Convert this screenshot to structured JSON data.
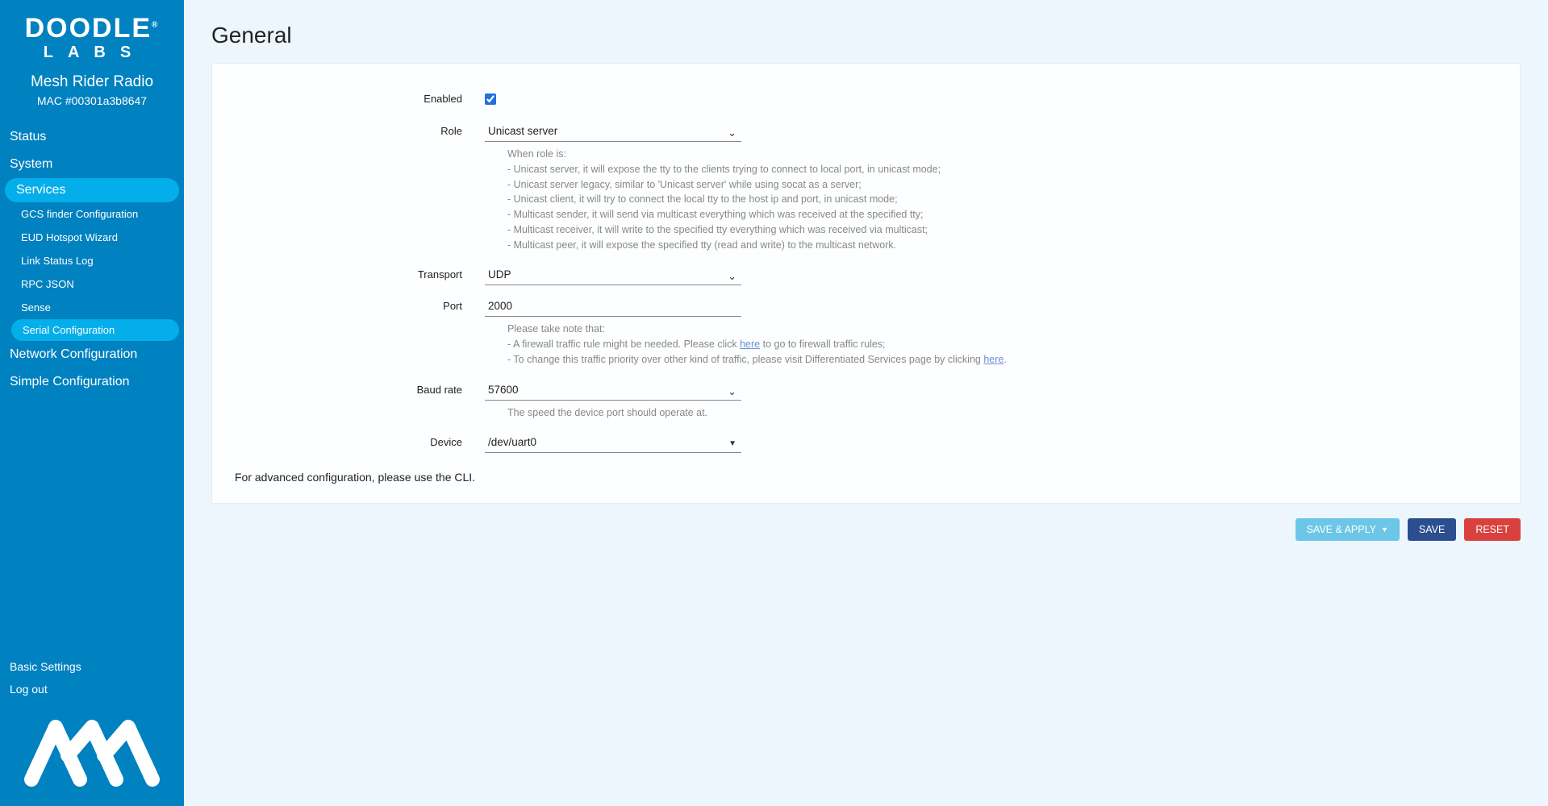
{
  "brand": {
    "line1": "DOODLE",
    "line2": "LABS",
    "product": "Mesh Rider Radio",
    "mac": "MAC #00301a3b8647"
  },
  "nav": {
    "items": [
      {
        "label": "Status"
      },
      {
        "label": "System"
      },
      {
        "label": "Services",
        "active": true
      },
      {
        "label": "Network Configuration"
      },
      {
        "label": "Simple Configuration"
      }
    ],
    "services_sub": [
      {
        "label": "GCS finder Configuration"
      },
      {
        "label": "EUD Hotspot Wizard"
      },
      {
        "label": "Link Status Log"
      },
      {
        "label": "RPC JSON"
      },
      {
        "label": "Sense"
      },
      {
        "label": "Serial Configuration",
        "active": true
      }
    ],
    "bottom": [
      {
        "label": "Basic Settings"
      },
      {
        "label": "Log out"
      }
    ]
  },
  "page": {
    "title": "General"
  },
  "form": {
    "enabled": {
      "label": "Enabled",
      "checked": true
    },
    "role": {
      "label": "Role",
      "value": "Unicast server",
      "help_intro": "When role is:",
      "help_lines": [
        "- Unicast server, it will expose the tty to the clients trying to connect to local port, in unicast mode;",
        "- Unicast server legacy, similar to 'Unicast server' while using socat as a server;",
        "- Unicast client, it will try to connect the local tty to the host ip and port, in unicast mode;",
        "- Multicast sender, it will send via multicast everything which was received at the specified tty;",
        "- Multicast receiver, it will write to the specified tty everything which was received via multicast;",
        "- Multicast peer, it will expose the specified tty (read and write) to the multicast network."
      ]
    },
    "transport": {
      "label": "Transport",
      "value": "UDP"
    },
    "port": {
      "label": "Port",
      "value": "2000",
      "help_intro": "Please take note that:",
      "help_line1_a": "- A firewall traffic rule might be needed. Please click ",
      "help_line1_link": "here",
      "help_line1_b": " to go to firewall traffic rules;",
      "help_line2_a": "- To change this traffic priority over other kind of traffic, please visit Differentiated Services page by clicking ",
      "help_line2_link": "here",
      "help_line2_b": "."
    },
    "baud": {
      "label": "Baud rate",
      "value": "57600",
      "help": "The speed the device port should operate at."
    },
    "device": {
      "label": "Device",
      "value": "/dev/uart0"
    },
    "cli_note": "For advanced configuration, please use the CLI."
  },
  "actions": {
    "save_apply": "SAVE & APPLY",
    "save": "SAVE",
    "reset": "RESET"
  }
}
